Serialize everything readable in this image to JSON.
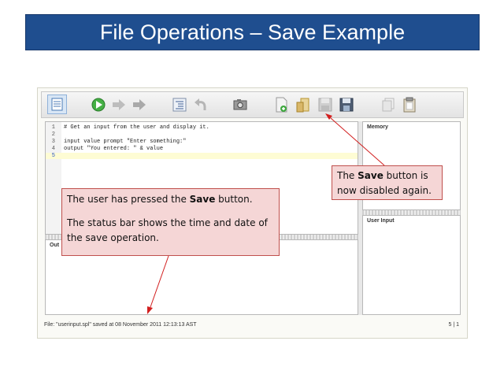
{
  "slide": {
    "title": "File Operations – Save Example"
  },
  "editor": {
    "lines": [
      {
        "num": "1",
        "text": "# Get an input from the user and display it."
      },
      {
        "num": "2",
        "text": ""
      },
      {
        "num": "3",
        "text": "input value prompt \"Enter something:\""
      },
      {
        "num": "4",
        "text": "output \"You entered: \" & value"
      },
      {
        "num": "5",
        "text": ""
      }
    ],
    "active_line": "5"
  },
  "panels": {
    "output_label": "Out",
    "memory_label": "Memory",
    "user_input_label": "User Input"
  },
  "status": {
    "file_text": "File:  \"userinput.spl\" saved at 08 November 2011 12:13:13 AST",
    "position": "5 | 1"
  },
  "callouts": {
    "save_disabled": {
      "line1_pre": "The ",
      "line1_bold": "Save",
      "line1_post": " button is",
      "line2": "now disabled again."
    },
    "user_pressed": {
      "p1_pre": "The user has pressed the ",
      "p1_bold": "Save",
      "p1_post": " button.",
      "p2": "The status bar shows the time and date of the save operation."
    }
  },
  "toolbar": {
    "icons": [
      "list-icon",
      "run-icon",
      "step-icon",
      "step-over-icon",
      "indent-icon",
      "undo-icon",
      "screenshot-icon",
      "new-file-icon",
      "open-icon",
      "save-disabled-icon",
      "save-as-icon",
      "copy-icon",
      "paste-icon"
    ]
  },
  "colors": {
    "banner": "#1f4e8f",
    "callout_fill": "#f5d6d6",
    "callout_border": "#c0504d",
    "run_green": "#3aa63a"
  }
}
